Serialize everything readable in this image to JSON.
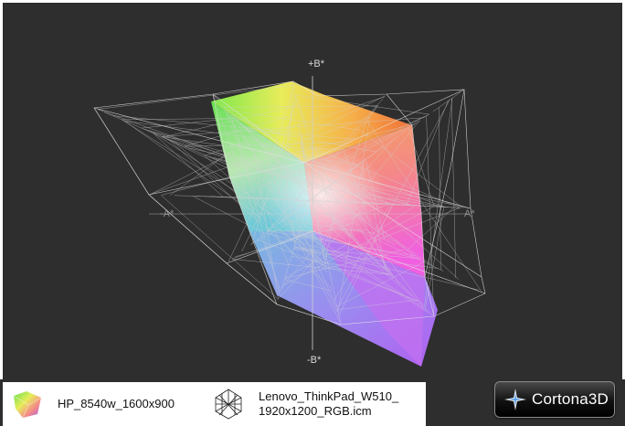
{
  "viewer": {
    "axes": {
      "b_plus": "+B*",
      "b_minus": "-B*",
      "a_minus": "-A*",
      "a_plus": "A*"
    }
  },
  "legend": {
    "items": [
      {
        "label": "HP_8540w_1600x900",
        "icon": "colored-gamut-icon"
      },
      {
        "label_line1": "Lenovo_ThinkPad_W510_",
        "label_line2": "1920x1200_RGB.icm",
        "icon": "wireframe-gamut-icon"
      }
    ]
  },
  "logo": {
    "text": "Cortona3D",
    "icon": "cortona-star-icon"
  }
}
